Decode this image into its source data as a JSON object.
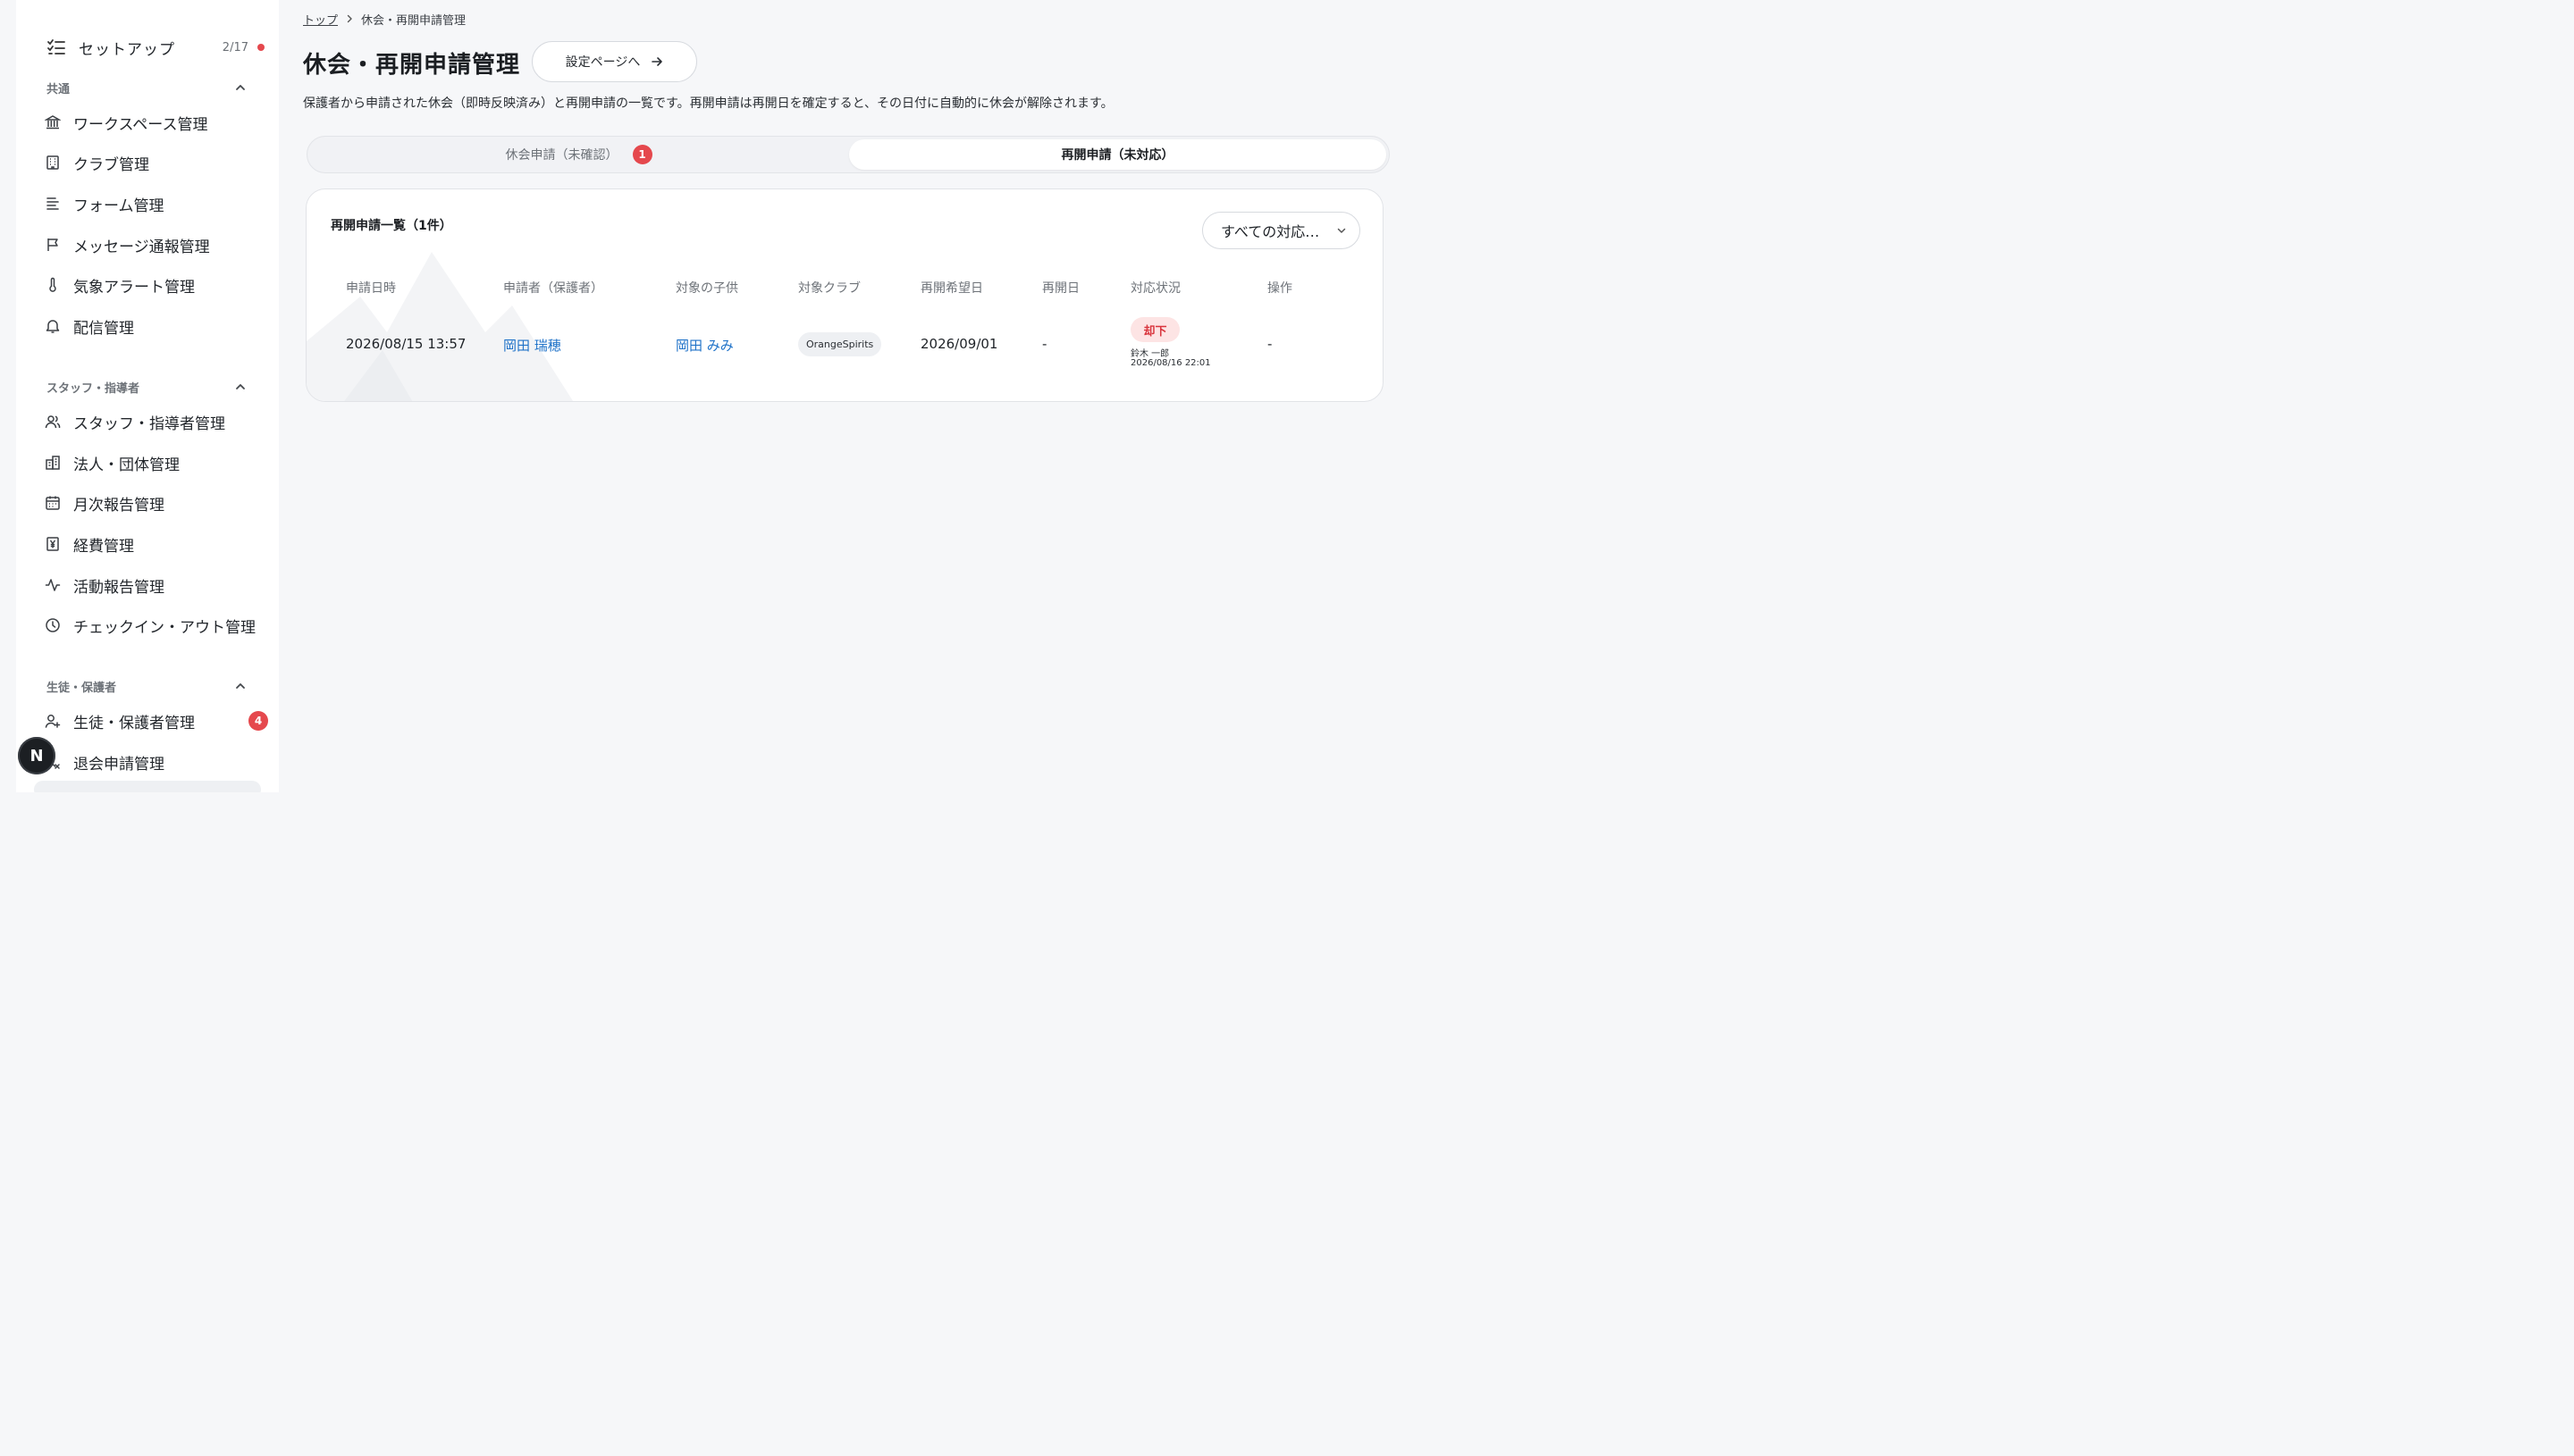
{
  "sidebar": {
    "setup": {
      "label": "セットアップ",
      "count": "2/17"
    },
    "sections": [
      {
        "title": "共通",
        "items": [
          {
            "label": "ワークスペース管理",
            "icon": "bank-icon"
          },
          {
            "label": "クラブ管理",
            "icon": "building-icon"
          },
          {
            "label": "フォーム管理",
            "icon": "form-icon"
          },
          {
            "label": "メッセージ通報管理",
            "icon": "flag-icon"
          },
          {
            "label": "気象アラート管理",
            "icon": "thermometer-icon"
          },
          {
            "label": "配信管理",
            "icon": "bell-icon"
          }
        ]
      },
      {
        "title": "スタッフ・指導者",
        "items": [
          {
            "label": "スタッフ・指導者管理",
            "icon": "users-icon"
          },
          {
            "label": "法人・団体管理",
            "icon": "organization-icon"
          },
          {
            "label": "月次報告管理",
            "icon": "calendar-icon"
          },
          {
            "label": "経費管理",
            "icon": "yen-receipt-icon"
          },
          {
            "label": "活動報告管理",
            "icon": "activity-icon"
          },
          {
            "label": "チェックイン・アウト管理",
            "icon": "clock-icon"
          }
        ]
      },
      {
        "title": "生徒・保護者",
        "items": [
          {
            "label": "生徒・保護者管理",
            "icon": "user-plus-icon",
            "badge": "4"
          },
          {
            "label": "退会申請管理",
            "icon": "user-x-icon"
          }
        ]
      }
    ],
    "floating_button": "N"
  },
  "breadcrumb": {
    "home": "トップ",
    "current": "休会・再開申請管理"
  },
  "page": {
    "title": "休会・再開申請管理",
    "settings_button": "設定ページへ",
    "description": "保護者から申請された休会（即時反映済み）と再開申請の一覧です。再開申請は再開日を確定すると、その日付に自動的に休会が解除されます。"
  },
  "tabs": [
    {
      "label": "休会申請（未確認）",
      "badge": "1",
      "active": false
    },
    {
      "label": "再開申請（未対応）",
      "active": true
    }
  ],
  "list": {
    "title": "再開申請一覧（1件）",
    "filter_value": "すべての対応…",
    "columns": [
      "申請日時",
      "申請者（保護者）",
      "対象の子供",
      "対象クラブ",
      "再開希望日",
      "再開日",
      "対応状況",
      "操作"
    ],
    "rows": [
      {
        "applied_at": "2026/08/15 13:57",
        "applicant": "岡田 瑞穂",
        "child": "岡田 みみ",
        "club": "OrangeSpirits",
        "desired_date": "2026/09/01",
        "resume_date": "-",
        "status": "却下",
        "status_by": "鈴木 一郎",
        "status_at": "2026/08/16 22:01",
        "action": "-"
      }
    ]
  },
  "colors": {
    "accent_red": "#e5484d",
    "link_blue": "#1f72c8",
    "status_rejected_bg": "#fde4e4",
    "status_rejected_text": "#d9363e"
  }
}
